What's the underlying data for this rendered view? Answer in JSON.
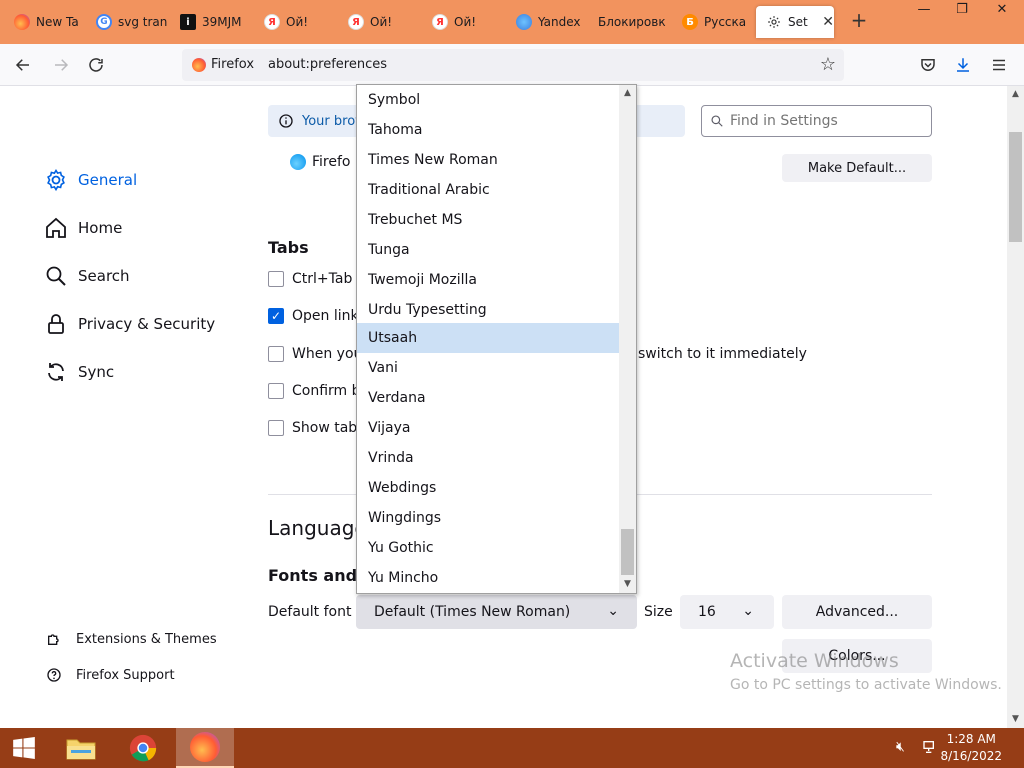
{
  "browser": {
    "tabs": [
      {
        "label": "New Ta",
        "favicon": "firefox-icon",
        "color": "#ff7139"
      },
      {
        "label": "svg tran",
        "favicon": "google-icon",
        "color": "#4285f4"
      },
      {
        "label": "39MJM",
        "favicon": "info-icon",
        "color": "#111111"
      },
      {
        "label": "Ой!",
        "favicon": "yandex-icon",
        "color": "#ff3333"
      },
      {
        "label": "Ой!",
        "favicon": "yandex-icon",
        "color": "#ff3333"
      },
      {
        "label": "Ой!",
        "favicon": "yandex-icon",
        "color": "#ff3333"
      },
      {
        "label": "Yandex",
        "favicon": "yandex-browser-icon",
        "color": "#3b7ddd"
      },
      {
        "label": "Блокировк",
        "favicon": "",
        "color": ""
      },
      {
        "label": "Русска",
        "favicon": "yandex-zen-icon",
        "color": "#ff8a00"
      }
    ],
    "active_tab": {
      "label": "Setti",
      "favicon": "gear-icon",
      "close": "✕"
    },
    "new_tab_symbol": "+",
    "window_controls": {
      "minimize": "—",
      "restore": "❐",
      "close": "✕"
    },
    "identity_label": "Firefox",
    "url": "about:preferences"
  },
  "sidebar": {
    "categories": [
      {
        "label": "General",
        "icon": "gear-icon",
        "selected": true
      },
      {
        "label": "Home",
        "icon": "home-icon",
        "selected": false
      },
      {
        "label": "Search",
        "icon": "search-icon",
        "selected": false
      },
      {
        "label": "Privacy & Security",
        "icon": "lock-icon",
        "selected": false
      },
      {
        "label": "Sync",
        "icon": "sync-icon",
        "selected": false
      }
    ],
    "footer": [
      {
        "label": "Extensions & Themes",
        "icon": "puzzle-icon"
      },
      {
        "label": "Firefox Support",
        "icon": "help-icon"
      }
    ]
  },
  "main": {
    "policy_text": "Your brov",
    "find_placeholder": "Find in Settings",
    "default_browser_text": "Firefo",
    "make_default_label": "Make Default...",
    "tabs_heading": "Tabs",
    "tab_options": [
      {
        "label": "Ctrl+Tab c",
        "checked": false
      },
      {
        "label": "Open links",
        "checked": true
      },
      {
        "label": "When you",
        "checked": false
      },
      {
        "label": "Confirm b",
        "checked": false
      },
      {
        "label": "Show tab",
        "checked": false
      }
    ],
    "tab_switch_suffix": "switch to it immediately",
    "language_heading": "Language",
    "fonts_heading": "Fonts and C",
    "default_font_label": "Default font",
    "default_font_value": "Default (Times New Roman)",
    "size_label": "Size",
    "size_value": "16",
    "advanced_label": "Advanced...",
    "colors_label": "Colors..."
  },
  "font_dropdown": {
    "options": [
      "Symbol",
      "Tahoma",
      "Times New Roman",
      "Traditional Arabic",
      "Trebuchet MS",
      "Tunga",
      "Twemoji Mozilla",
      "Urdu Typesetting",
      "Utsaah",
      "Vani",
      "Verdana",
      "Vijaya",
      "Vrinda",
      "Webdings",
      "Wingdings",
      "Yu Gothic",
      "Yu Mincho"
    ],
    "highlighted": "Utsaah"
  },
  "watermark": {
    "title": "Activate Windows",
    "subtitle": "Go to PC settings to activate Windows."
  },
  "taskbar": {
    "time": "1:28 AM",
    "date": "8/16/2022"
  },
  "colors": {
    "accent": "#0061e0",
    "tabstrip": "#f2935e",
    "taskbar": "#963d16",
    "highlight": "#cce0f5"
  }
}
